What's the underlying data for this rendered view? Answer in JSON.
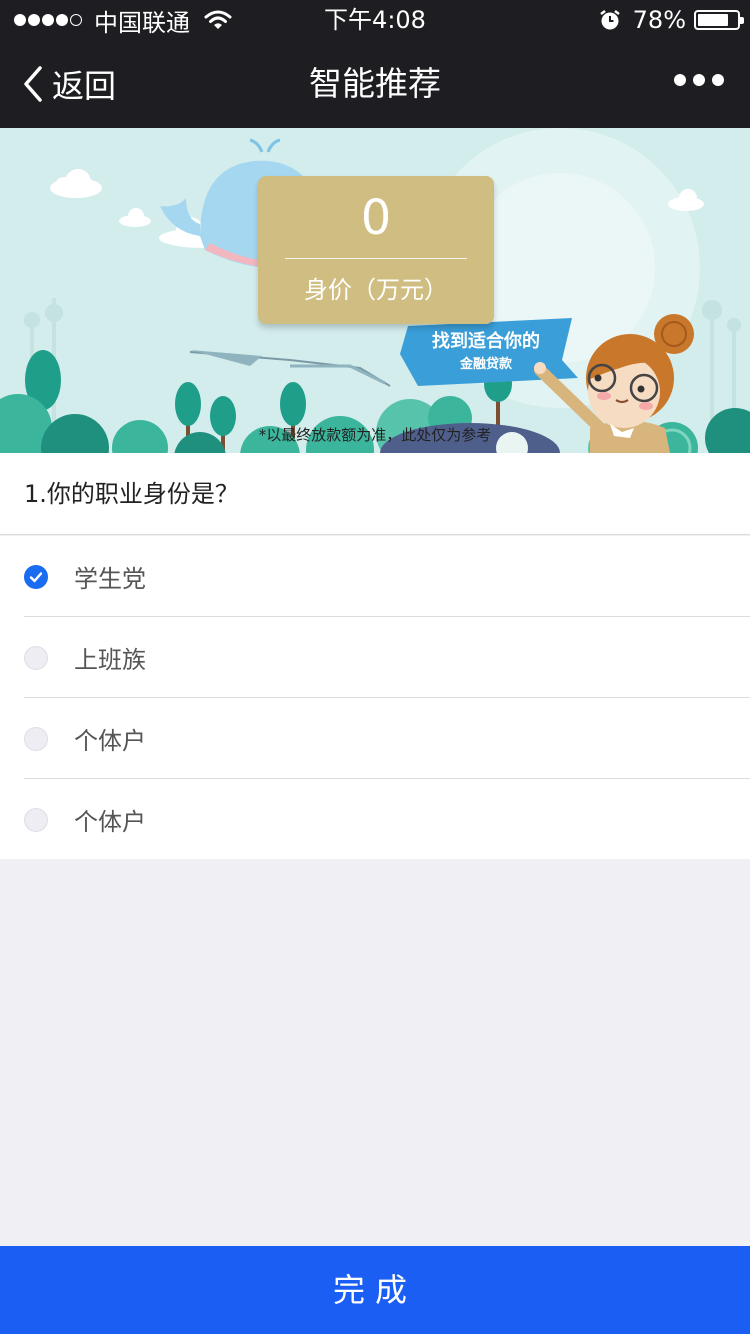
{
  "status_bar": {
    "carrier": "中国联通",
    "time": "下午4:08",
    "battery_percent_text": "78%",
    "battery_level": 0.78
  },
  "nav": {
    "back_label": "返回",
    "title": "智能推荐"
  },
  "banner": {
    "value": "0",
    "value_unit": "身价（万元）",
    "flag_main": "找到适合你的",
    "flag_sub": "金融贷款",
    "disclaimer": "*以最终放款额为准，此处仅为参考"
  },
  "question": {
    "text": "1.你的职业身份是？",
    "options": [
      {
        "label": "学生党",
        "checked": true
      },
      {
        "label": "上班族",
        "checked": false
      },
      {
        "label": "个体户",
        "checked": false
      },
      {
        "label": "个体户",
        "checked": false
      }
    ]
  },
  "footer": {
    "done_label": "完成"
  },
  "colors": {
    "bar_bg": "#1e1e22",
    "accent_blue": "#1a5ef3",
    "card_gold": "#cfbd82",
    "banner_bg": "#d3ecec"
  }
}
